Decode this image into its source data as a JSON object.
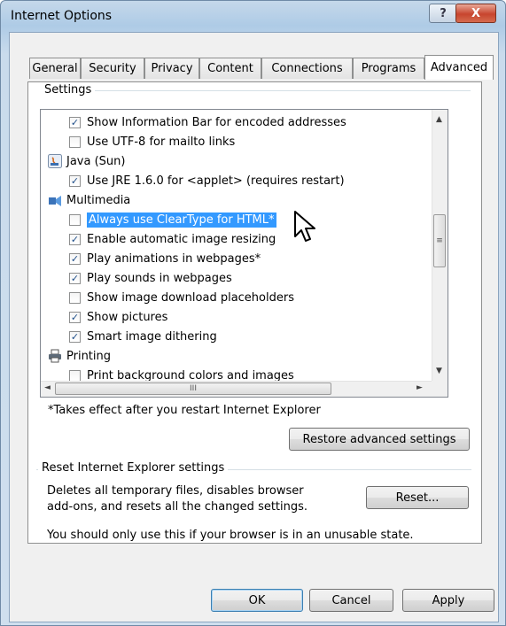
{
  "window": {
    "title": "Internet Options",
    "help_label": "?",
    "close_label": "X"
  },
  "tabs": [
    {
      "label": "General"
    },
    {
      "label": "Security"
    },
    {
      "label": "Privacy"
    },
    {
      "label": "Content"
    },
    {
      "label": "Connections"
    },
    {
      "label": "Programs"
    },
    {
      "label": "Advanced"
    }
  ],
  "settings": {
    "group_label": "Settings",
    "items": [
      {
        "label": "Show Information Bar for encoded addresses",
        "kind": "checkbox",
        "checked": true
      },
      {
        "label": "Use UTF-8 for mailto links",
        "kind": "checkbox",
        "checked": false
      },
      {
        "label": "Java (Sun)",
        "kind": "category",
        "icon": "java-icon"
      },
      {
        "label": "Use JRE 1.6.0 for <applet> (requires restart)",
        "kind": "checkbox",
        "checked": true
      },
      {
        "label": "Multimedia",
        "kind": "category",
        "icon": "multimedia-icon"
      },
      {
        "label": "Always use ClearType for HTML*",
        "kind": "checkbox",
        "checked": false,
        "selected": true
      },
      {
        "label": "Enable automatic image resizing",
        "kind": "checkbox",
        "checked": true
      },
      {
        "label": "Play animations in webpages*",
        "kind": "checkbox",
        "checked": true
      },
      {
        "label": "Play sounds in webpages",
        "kind": "checkbox",
        "checked": true
      },
      {
        "label": "Show image download placeholders",
        "kind": "checkbox",
        "checked": false
      },
      {
        "label": "Show pictures",
        "kind": "checkbox",
        "checked": true
      },
      {
        "label": "Smart image dithering",
        "kind": "checkbox",
        "checked": true
      },
      {
        "label": "Printing",
        "kind": "category",
        "icon": "printer-icon"
      },
      {
        "label": "Print background colors and images",
        "kind": "checkbox",
        "checked": false
      }
    ],
    "check_glyph": "✓",
    "footnote": "*Takes effect after you restart Internet Explorer",
    "restore_label": "Restore advanced settings",
    "scroll_up": "▲",
    "scroll_down": "▼",
    "scroll_left": "◄",
    "scroll_right": "►",
    "thumb_grip_v": "≡",
    "thumb_grip_h": "III"
  },
  "reset": {
    "group_label": "Reset Internet Explorer settings",
    "description_line1": "Deletes all temporary files, disables browser",
    "description_line2": "add-ons, and resets all the changed settings.",
    "button_label": "Reset...",
    "note": "You should only use this if your browser is in an unusable state."
  },
  "footer": {
    "ok_label": "OK",
    "cancel_label": "Cancel",
    "apply_label": "Apply"
  }
}
